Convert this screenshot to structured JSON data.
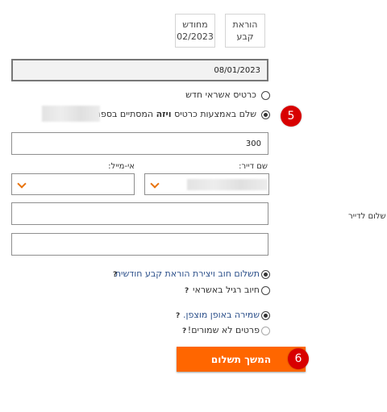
{
  "colors": {
    "accent": "#ff6600",
    "badge": "#d80000",
    "link": "#2b4f8a",
    "chevron": "#e8730c"
  },
  "tabs": [
    {
      "line1": "הוראת",
      "line2": "קבע"
    },
    {
      "line1": "מחודש",
      "line2": "02/2023"
    }
  ],
  "date_field": {
    "value": "08/01/2023"
  },
  "payment_method": {
    "new_card_label": "כרטיס אשראי חדש",
    "existing_card_prefix": "שלם באמצעות כרטיס",
    "existing_card_brand": "ויזה",
    "existing_card_suffix": "המסתיים בספרות",
    "new_card_selected": false,
    "existing_card_selected": true
  },
  "badges": {
    "step5": "5",
    "step6": "6"
  },
  "amount_field": {
    "value": "300"
  },
  "tenant_name": {
    "label": "שם דייר:",
    "chevron_icon": "chevron-down-icon"
  },
  "email": {
    "label": "אי-מייל:",
    "chevron_icon": "chevron-down-icon"
  },
  "side_label": "שלום לדייר",
  "charge_type": {
    "monthly_label": "תשלום חוב ויצירת הוראת קבע חודשית",
    "regular_label": "חיוב רגיל באשראי",
    "monthly_selected": true,
    "help": "?"
  },
  "save_details": {
    "encrypted_label": "שמירה באופן מוצפן.",
    "not_saved_label": "פרטים לא שמורים!",
    "encrypted_selected": true,
    "help": "?"
  },
  "continue_button": {
    "label": "המשך תשלום"
  }
}
